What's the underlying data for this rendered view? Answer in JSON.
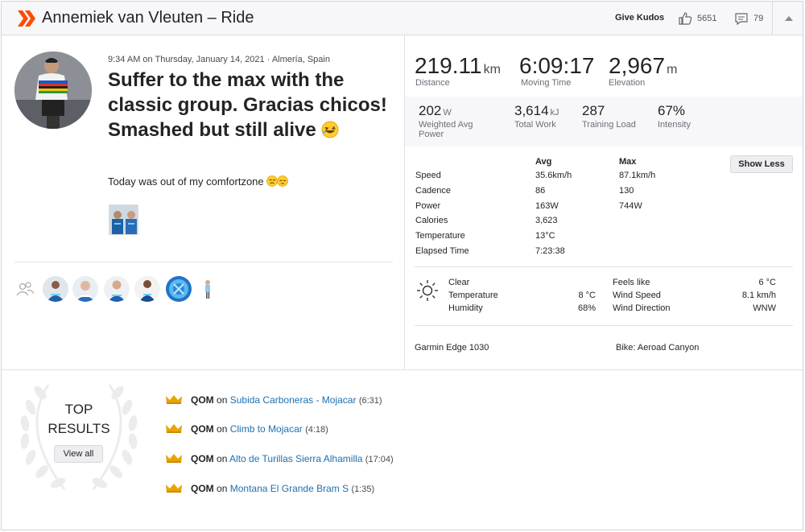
{
  "header": {
    "title": "Annemiek van Vleuten – Ride",
    "give_kudos": "Give Kudos",
    "kudos_count": "5651",
    "comment_count": "79",
    "brand_color": "#fc4c02"
  },
  "activity": {
    "meta": "9:34 AM on Thursday, January 14, 2021 · Almería, Spain",
    "title": "Suffer to the max with the classic group. Gracias chicos! Smashed but still alive",
    "description": "Today was out of my comfortzone"
  },
  "primary_stats": [
    {
      "value": "219.11",
      "unit": "km",
      "label": "Distance"
    },
    {
      "value": "6:09:17",
      "unit": "",
      "label": "Moving Time"
    },
    {
      "value": "2,967",
      "unit": "m",
      "label": "Elevation"
    }
  ],
  "secondary_stats": [
    {
      "value": "202",
      "unit": "W",
      "label": "Weighted Avg Power"
    },
    {
      "value": "3,614",
      "unit": "kJ",
      "label": "Total Work"
    },
    {
      "value": "287",
      "unit": "",
      "label": "Training Load"
    },
    {
      "value": "67%",
      "unit": "",
      "label": "Intensity"
    }
  ],
  "stats_table": {
    "avg_header": "Avg",
    "max_header": "Max",
    "show_less_label": "Show Less",
    "rows": [
      {
        "label": "Speed",
        "avg": "35.6km/h",
        "max": "87.1km/h"
      },
      {
        "label": "Cadence",
        "avg": "86",
        "max": "130"
      },
      {
        "label": "Power",
        "avg": "163W",
        "max": "744W"
      },
      {
        "label": "Calories",
        "avg": "3,623",
        "max": ""
      },
      {
        "label": "Temperature",
        "avg": "13°C",
        "max": ""
      },
      {
        "label": "Elapsed Time",
        "avg": "7:23:38",
        "max": ""
      }
    ]
  },
  "weather": {
    "condition": "Clear",
    "temperature_label": "Temperature",
    "temperature_value": "8 °C",
    "humidity_label": "Humidity",
    "humidity_value": "68%",
    "feels_like_label": "Feels like",
    "feels_like_value": "6 °C",
    "wind_speed_label": "Wind Speed",
    "wind_speed_value": "8.1 km/h",
    "wind_direction_label": "Wind Direction",
    "wind_direction_value": "WNW"
  },
  "equipment": {
    "device": "Garmin Edge 1030",
    "bike": "Bike: Aeroad Canyon"
  },
  "top_results": {
    "heading_line1": "TOP",
    "heading_line2": "RESULTS",
    "view_all": "View all",
    "results": [
      {
        "award": "QOM",
        "on": "on",
        "segment": "Subida Carboneras - Mojacar",
        "time": "(6:31)"
      },
      {
        "award": "QOM",
        "on": "on",
        "segment": "Climb to Mojacar",
        "time": "(4:18)"
      },
      {
        "award": "QOM",
        "on": "on",
        "segment": "Alto de Turillas Sierra Alhamilla",
        "time": "(17:04)"
      },
      {
        "award": "QOM",
        "on": "on",
        "segment": "Montana El Grande Bram S",
        "time": "(1:35)"
      }
    ]
  },
  "colors": {
    "link": "#1e6fb0",
    "crown": "#e8a400"
  }
}
